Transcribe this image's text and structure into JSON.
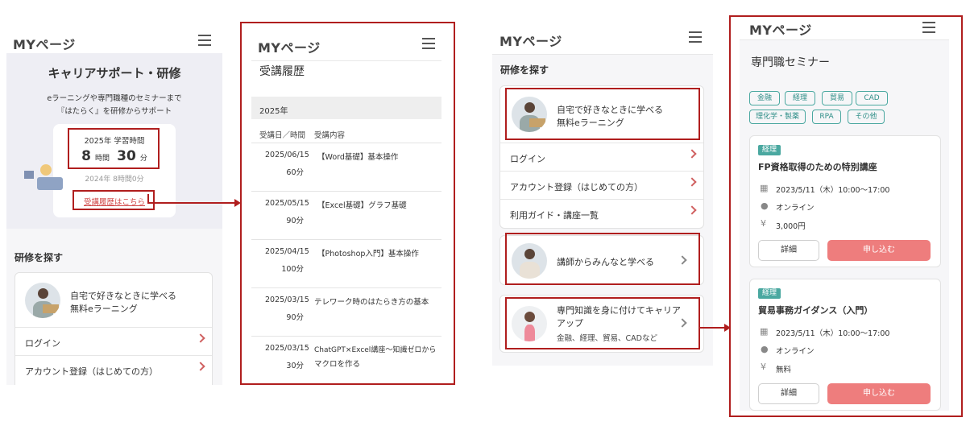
{
  "common": {
    "logo": "MYページ"
  },
  "screen1": {
    "hero_title": "キャリアサポート・研修",
    "hero_desc_1": "eラーニングや専門職種のセミナーまで",
    "hero_desc_2": "『はたらく』を研修からサポート",
    "study_label": "2025年 学習時間",
    "study_hours": "8",
    "study_hours_unit": "時間",
    "study_minutes": "30",
    "study_minutes_unit": "分",
    "prev_study": "2024年 8時間0分",
    "history_link": "受講履歴はこちら",
    "section_title": "研修を探す",
    "elearning_line1": "自宅で好きなときに学べる",
    "elearning_line2": "無料eラーニング",
    "login": "ログイン",
    "register": "アカウント登録（はじめての方）"
  },
  "screen2": {
    "title": "受講履歴",
    "year": "2025年",
    "col_date": "受講日／時間",
    "col_content": "受講内容",
    "rows": [
      {
        "date": "2025/06/15",
        "time": "60分",
        "content": "【Word基礎】基本操作",
        "content2": ""
      },
      {
        "date": "2025/05/15",
        "time": "90分",
        "content": "【Excel基礎】グラフ基礎",
        "content2": ""
      },
      {
        "date": "2025/04/15",
        "time": "100分",
        "content": "【Photoshop入門】基本操作",
        "content2": ""
      },
      {
        "date": "2025/03/15",
        "time": "90分",
        "content": "テレワーク時のはたらき方の基本",
        "content2": ""
      },
      {
        "date": "2025/03/15",
        "time": "30分",
        "content": "ChatGPT×Excel講座〜知識ゼロから",
        "content2": "マクロを作る"
      }
    ]
  },
  "screen3": {
    "section_title": "研修を探す",
    "elearning_line1": "自宅で好きなときに学べる",
    "elearning_line2": "無料eラーニング",
    "login": "ログイン",
    "register": "アカウント登録（はじめての方）",
    "guide": "利用ガイド・講座一覧",
    "instructor": "講師からみんなと学べる",
    "career_line1": "専門知識を身に付けてキャリア",
    "career_line2": "アップ",
    "career_line3": "金融、経理、貿易、CADなど"
  },
  "screen4": {
    "title": "専門職セミナー",
    "tags": [
      "金融",
      "経理",
      "貿易",
      "CAD",
      "理化学・製薬",
      "RPA",
      "その他"
    ],
    "seminars": [
      {
        "badge": "経理",
        "title": "FP資格取得のための特別講座",
        "datetime": "2023/5/11（木）10:00〜17:00",
        "place": "オンライン",
        "price": "3,000円",
        "detail": "詳細",
        "apply": "申し込む"
      },
      {
        "badge": "経理",
        "title": "貿易事務ガイダンス（入門）",
        "datetime": "2023/5/11（木）10:00〜17:00",
        "place": "オンライン",
        "price": "無料",
        "detail": "詳細",
        "apply": "申し込む"
      }
    ]
  },
  "colors": {
    "accent_red": "#b01e1e",
    "teal": "#4aa8a0",
    "apply_button": "#ee7d7d",
    "panel_gray": "#f4f4f6"
  },
  "icons": {
    "calendar": "calendar-icon",
    "location": "location-icon",
    "yen": "yen-icon",
    "menu": "hamburger-menu-icon",
    "arrow": "chevron-right-icon"
  }
}
